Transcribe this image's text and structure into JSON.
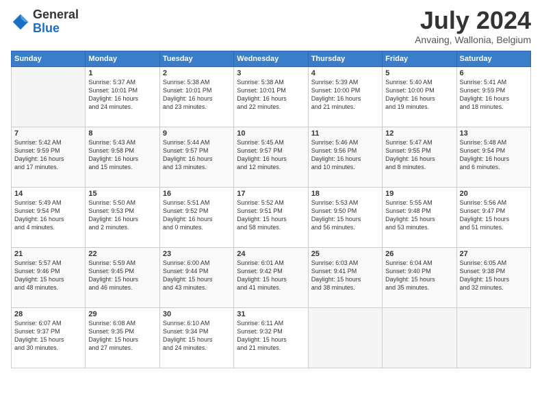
{
  "header": {
    "logo_line1": "General",
    "logo_line2": "Blue",
    "month_title": "July 2024",
    "location": "Anvaing, Wallonia, Belgium"
  },
  "calendar": {
    "days_of_week": [
      "Sunday",
      "Monday",
      "Tuesday",
      "Wednesday",
      "Thursday",
      "Friday",
      "Saturday"
    ],
    "weeks": [
      [
        {
          "day": "",
          "info": ""
        },
        {
          "day": "1",
          "info": "Sunrise: 5:37 AM\nSunset: 10:01 PM\nDaylight: 16 hours\nand 24 minutes."
        },
        {
          "day": "2",
          "info": "Sunrise: 5:38 AM\nSunset: 10:01 PM\nDaylight: 16 hours\nand 23 minutes."
        },
        {
          "day": "3",
          "info": "Sunrise: 5:38 AM\nSunset: 10:01 PM\nDaylight: 16 hours\nand 22 minutes."
        },
        {
          "day": "4",
          "info": "Sunrise: 5:39 AM\nSunset: 10:00 PM\nDaylight: 16 hours\nand 21 minutes."
        },
        {
          "day": "5",
          "info": "Sunrise: 5:40 AM\nSunset: 10:00 PM\nDaylight: 16 hours\nand 19 minutes."
        },
        {
          "day": "6",
          "info": "Sunrise: 5:41 AM\nSunset: 9:59 PM\nDaylight: 16 hours\nand 18 minutes."
        }
      ],
      [
        {
          "day": "7",
          "info": "Sunrise: 5:42 AM\nSunset: 9:59 PM\nDaylight: 16 hours\nand 17 minutes."
        },
        {
          "day": "8",
          "info": "Sunrise: 5:43 AM\nSunset: 9:58 PM\nDaylight: 16 hours\nand 15 minutes."
        },
        {
          "day": "9",
          "info": "Sunrise: 5:44 AM\nSunset: 9:57 PM\nDaylight: 16 hours\nand 13 minutes."
        },
        {
          "day": "10",
          "info": "Sunrise: 5:45 AM\nSunset: 9:57 PM\nDaylight: 16 hours\nand 12 minutes."
        },
        {
          "day": "11",
          "info": "Sunrise: 5:46 AM\nSunset: 9:56 PM\nDaylight: 16 hours\nand 10 minutes."
        },
        {
          "day": "12",
          "info": "Sunrise: 5:47 AM\nSunset: 9:55 PM\nDaylight: 16 hours\nand 8 minutes."
        },
        {
          "day": "13",
          "info": "Sunrise: 5:48 AM\nSunset: 9:54 PM\nDaylight: 16 hours\nand 6 minutes."
        }
      ],
      [
        {
          "day": "14",
          "info": "Sunrise: 5:49 AM\nSunset: 9:54 PM\nDaylight: 16 hours\nand 4 minutes."
        },
        {
          "day": "15",
          "info": "Sunrise: 5:50 AM\nSunset: 9:53 PM\nDaylight: 16 hours\nand 2 minutes."
        },
        {
          "day": "16",
          "info": "Sunrise: 5:51 AM\nSunset: 9:52 PM\nDaylight: 16 hours\nand 0 minutes."
        },
        {
          "day": "17",
          "info": "Sunrise: 5:52 AM\nSunset: 9:51 PM\nDaylight: 15 hours\nand 58 minutes."
        },
        {
          "day": "18",
          "info": "Sunrise: 5:53 AM\nSunset: 9:50 PM\nDaylight: 15 hours\nand 56 minutes."
        },
        {
          "day": "19",
          "info": "Sunrise: 5:55 AM\nSunset: 9:48 PM\nDaylight: 15 hours\nand 53 minutes."
        },
        {
          "day": "20",
          "info": "Sunrise: 5:56 AM\nSunset: 9:47 PM\nDaylight: 15 hours\nand 51 minutes."
        }
      ],
      [
        {
          "day": "21",
          "info": "Sunrise: 5:57 AM\nSunset: 9:46 PM\nDaylight: 15 hours\nand 48 minutes."
        },
        {
          "day": "22",
          "info": "Sunrise: 5:59 AM\nSunset: 9:45 PM\nDaylight: 15 hours\nand 46 minutes."
        },
        {
          "day": "23",
          "info": "Sunrise: 6:00 AM\nSunset: 9:44 PM\nDaylight: 15 hours\nand 43 minutes."
        },
        {
          "day": "24",
          "info": "Sunrise: 6:01 AM\nSunset: 9:42 PM\nDaylight: 15 hours\nand 41 minutes."
        },
        {
          "day": "25",
          "info": "Sunrise: 6:03 AM\nSunset: 9:41 PM\nDaylight: 15 hours\nand 38 minutes."
        },
        {
          "day": "26",
          "info": "Sunrise: 6:04 AM\nSunset: 9:40 PM\nDaylight: 15 hours\nand 35 minutes."
        },
        {
          "day": "27",
          "info": "Sunrise: 6:05 AM\nSunset: 9:38 PM\nDaylight: 15 hours\nand 32 minutes."
        }
      ],
      [
        {
          "day": "28",
          "info": "Sunrise: 6:07 AM\nSunset: 9:37 PM\nDaylight: 15 hours\nand 30 minutes."
        },
        {
          "day": "29",
          "info": "Sunrise: 6:08 AM\nSunset: 9:35 PM\nDaylight: 15 hours\nand 27 minutes."
        },
        {
          "day": "30",
          "info": "Sunrise: 6:10 AM\nSunset: 9:34 PM\nDaylight: 15 hours\nand 24 minutes."
        },
        {
          "day": "31",
          "info": "Sunrise: 6:11 AM\nSunset: 9:32 PM\nDaylight: 15 hours\nand 21 minutes."
        },
        {
          "day": "",
          "info": ""
        },
        {
          "day": "",
          "info": ""
        },
        {
          "day": "",
          "info": ""
        }
      ]
    ]
  }
}
